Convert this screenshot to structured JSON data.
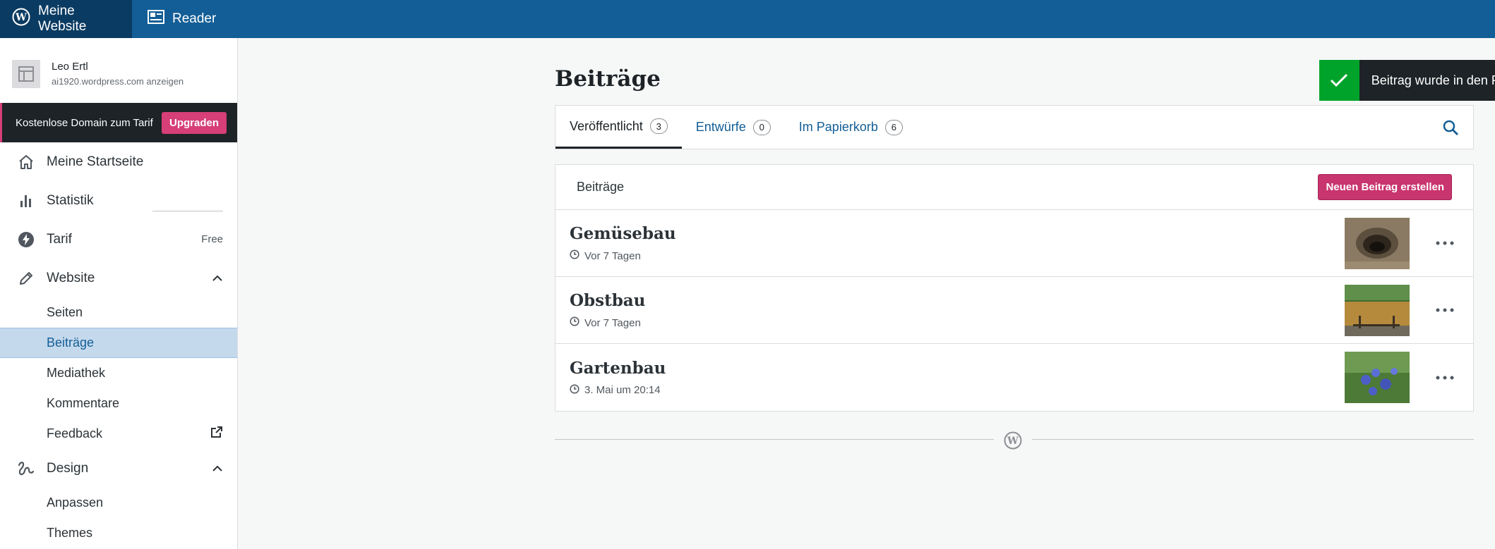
{
  "topbar": {
    "site_label": "Meine Website",
    "reader_label": "Reader"
  },
  "sidebar": {
    "site": {
      "name": "Leo Ertl",
      "url": "ai1920.wordpress.com anzeigen"
    },
    "promo": {
      "text": "Kostenlose Domain zum Tarif",
      "button": "Upgraden"
    },
    "items": [
      {
        "label": "Meine Startseite",
        "icon": "home-icon"
      },
      {
        "label": "Statistik",
        "icon": "bar-chart-icon"
      },
      {
        "label": "Tarif",
        "icon": "plan-icon",
        "extra": "Free"
      },
      {
        "label": "Website",
        "icon": "pencil-icon"
      },
      {
        "label": "Design",
        "icon": "design-icon"
      }
    ],
    "website_sub": [
      {
        "label": "Seiten"
      },
      {
        "label": "Beiträge"
      },
      {
        "label": "Mediathek"
      },
      {
        "label": "Kommentare"
      },
      {
        "label": "Feedback"
      }
    ],
    "design_sub": [
      {
        "label": "Anpassen"
      },
      {
        "label": "Themes"
      }
    ]
  },
  "main": {
    "title": "Beiträge",
    "tabs": [
      {
        "label": "Veröffentlicht",
        "count": "3"
      },
      {
        "label": "Entwürfe",
        "count": "0"
      },
      {
        "label": "Im Papierkorb",
        "count": "6"
      }
    ],
    "list_header": "Beiträge",
    "new_post_button": "Neuen Beitrag erstellen",
    "posts": [
      {
        "title": "Gemüsebau",
        "meta": "Vor 7 Tagen"
      },
      {
        "title": "Obstbau",
        "meta": "Vor 7 Tagen"
      },
      {
        "title": "Gartenbau",
        "meta": "3. Mai um 20:14"
      }
    ]
  },
  "toast": {
    "text": "Beitrag wurde in den P"
  },
  "colors": {
    "topbar": "#135e96",
    "topbar_active": "#0a3b62",
    "accent_pink": "#c9356e",
    "toast_success": "#00a32a",
    "selected_bg": "#c5d9ed"
  }
}
